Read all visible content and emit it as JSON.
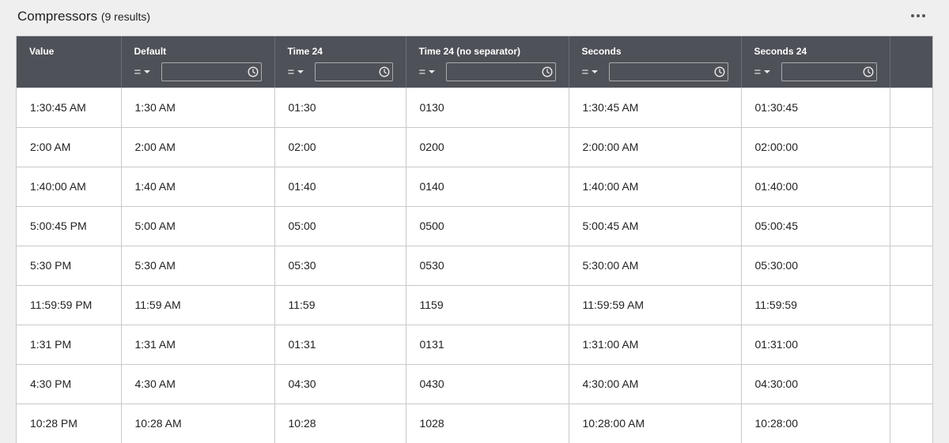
{
  "header": {
    "title": "Compressors",
    "result_count": "(9 results)",
    "more_icon": "more-horizontal-icon"
  },
  "columns": [
    {
      "label": "Value",
      "has_filter": false
    },
    {
      "label": "Default",
      "has_filter": true,
      "operator": "=",
      "filter_value": ""
    },
    {
      "label": "Time 24",
      "has_filter": true,
      "operator": "=",
      "filter_value": ""
    },
    {
      "label": "Time 24 (no separator)",
      "has_filter": true,
      "operator": "=",
      "filter_value": ""
    },
    {
      "label": "Seconds",
      "has_filter": true,
      "operator": "=",
      "filter_value": ""
    },
    {
      "label": "Seconds 24",
      "has_filter": true,
      "operator": "=",
      "filter_value": ""
    },
    {
      "label": "",
      "has_filter": false
    }
  ],
  "rows": [
    [
      "1:30:45 AM",
      "1:30 AM",
      "01:30",
      "0130",
      "1:30:45 AM",
      "01:30:45",
      ""
    ],
    [
      "2:00 AM",
      "2:00 AM",
      "02:00",
      "0200",
      "2:00:00 AM",
      "02:00:00",
      ""
    ],
    [
      "1:40:00 AM",
      "1:40 AM",
      "01:40",
      "0140",
      "1:40:00 AM",
      "01:40:00",
      ""
    ],
    [
      "5:00:45 PM",
      "5:00 AM",
      "05:00",
      "0500",
      "5:00:45 AM",
      "05:00:45",
      ""
    ],
    [
      "5:30 PM",
      "5:30 AM",
      "05:30",
      "0530",
      "5:30:00 AM",
      "05:30:00",
      ""
    ],
    [
      "11:59:59 PM",
      "11:59 AM",
      "11:59",
      "1159",
      "11:59:59 AM",
      "11:59:59",
      ""
    ],
    [
      "1:31 PM",
      "1:31 AM",
      "01:31",
      "0131",
      "1:31:00 AM",
      "01:31:00",
      ""
    ],
    [
      "4:30 PM",
      "4:30 AM",
      "04:30",
      "0430",
      "4:30:00 AM",
      "04:30:00",
      ""
    ],
    [
      "10:28 PM",
      "10:28 AM",
      "10:28",
      "1028",
      "10:28:00 AM",
      "10:28:00",
      ""
    ]
  ],
  "colors": {
    "header_bg": "#4f5159",
    "header_text": "#ffffff",
    "page_bg": "#efefef",
    "grid_line": "#c9c9c9"
  }
}
